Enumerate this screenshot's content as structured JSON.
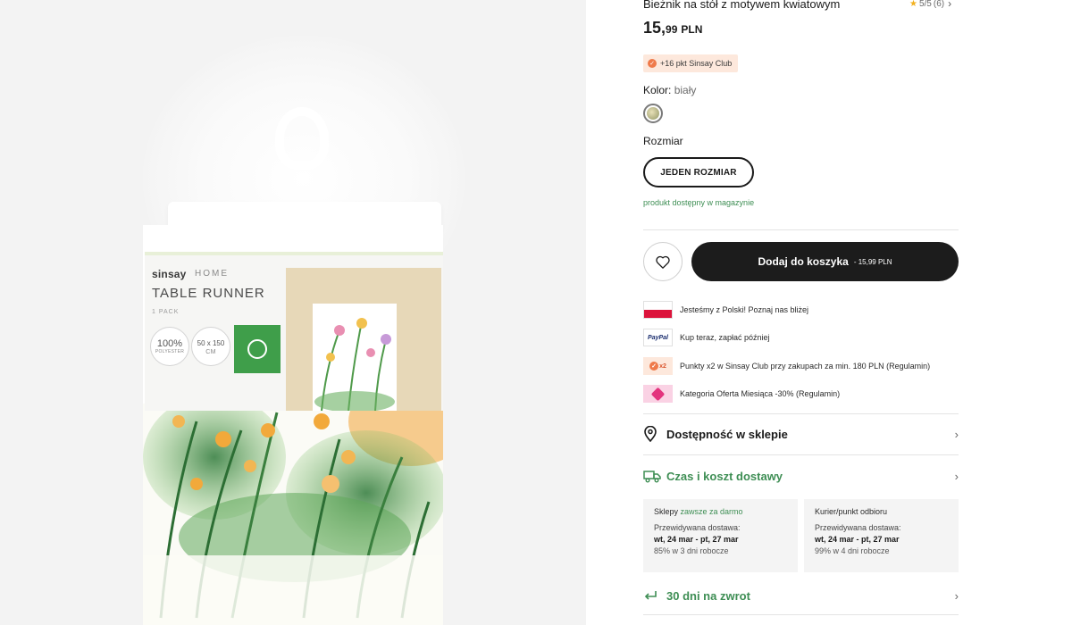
{
  "product": {
    "title": "Bieżnik na stół z motywem kwiatowym",
    "rating_value": "5/5",
    "rating_count": "(6)",
    "price_main": "15,",
    "price_cents": "99",
    "price_currency": "PLN",
    "club_points": "+16 pkt Sinsay Club",
    "color_label": "Kolor:",
    "color_value": "biały",
    "size_label": "Rozmiar",
    "size_option": "JEDEN ROZMIAR",
    "stock_status": "produkt dostępny w magazynie"
  },
  "package": {
    "brand": "sinsay",
    "brand_line": "HOME",
    "title": "TABLE RUNNER",
    "pack": "1 PACK",
    "material_big": "100%",
    "material_small": "POLYESTER",
    "size_big": "50 x 150",
    "size_small": "CM"
  },
  "cart": {
    "button_label": "Dodaj do koszyka",
    "button_price": "15,99 PLN"
  },
  "perks": [
    {
      "icon": "poland-flag-icon",
      "text": "Jesteśmy z Polski! Poznaj nas bliżej"
    },
    {
      "icon": "paypal-icon",
      "icon_text": "PayPal",
      "text": "Kup teraz, zapłać później"
    },
    {
      "icon": "club-points-icon",
      "icon_text": "x2",
      "text": "Punkty x2 w Sinsay Club przy zakupach za min. 180 PLN (Regulamin)"
    },
    {
      "icon": "discount-tag-icon",
      "text": "Kategoria Oferta Miesiąca -30% (Regulamin)"
    }
  ],
  "sections": {
    "store_availability": "Dostępność w sklepie",
    "delivery": "Czas i koszt dostawy",
    "returns": "30 dni na zwrot"
  },
  "delivery_options": [
    {
      "name": "Sklepy",
      "highlight": "zawsze za darmo",
      "estimate_label": "Przewidywana dostawa:",
      "date_range": "wt, 24 mar - pt, 27 mar",
      "reliability": "85% w 3 dni robocze"
    },
    {
      "name": "Kurier/punkt odbioru",
      "highlight": "",
      "estimate_label": "Przewidywana dostawa:",
      "date_range": "wt, 24 mar - pt, 27 mar",
      "reliability": "99% w 4 dni robocze"
    }
  ],
  "colors": {
    "accent_green": "#3e8e54",
    "cart_button": "#1c1c1c",
    "club_badge_bg": "#fde8dc"
  }
}
